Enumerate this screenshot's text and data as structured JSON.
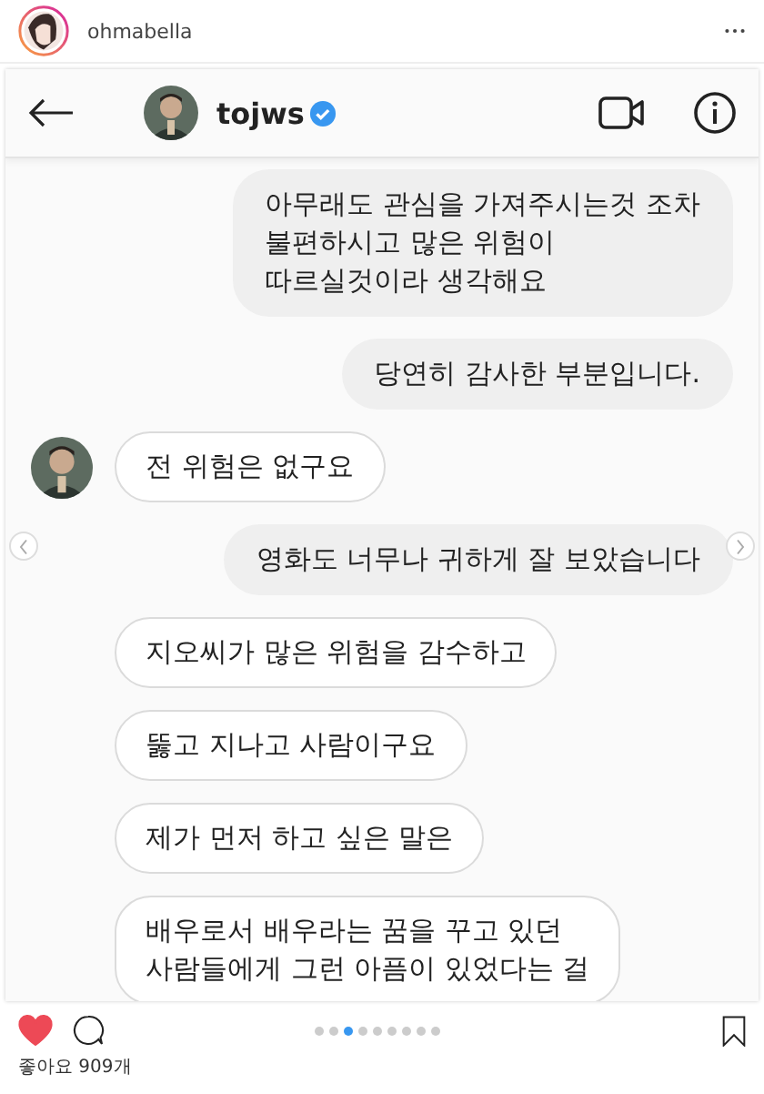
{
  "post": {
    "username": "ohmabella"
  },
  "chat": {
    "username": "tojws",
    "verified": true,
    "messages": [
      {
        "kind": "sent",
        "text": "아무래도 관심을 가져주시는것 조차\n불편하시고 많은 위험이\n따르실것이라 생각해요",
        "avatar": false
      },
      {
        "kind": "sent",
        "text": "당연히 감사한 부분입니다.",
        "avatar": false
      },
      {
        "kind": "received",
        "text": "전 위험은 없구요",
        "avatar": true
      },
      {
        "kind": "sent",
        "text": "영화도 너무나 귀하게 잘 보았습니다",
        "avatar": false
      },
      {
        "kind": "received",
        "text": "지오씨가 많은 위험을 감수하고",
        "avatar": false
      },
      {
        "kind": "received",
        "text": "뚫고 지나고 사람이구요",
        "avatar": false
      },
      {
        "kind": "received",
        "text": "제가 먼저 하고 싶은 말은",
        "avatar": false
      },
      {
        "kind": "received",
        "text": "배우로서 배우라는 꿈을 꾸고 있던\n사람들에게 그런 아픔이 있었다는 걸",
        "avatar": false
      }
    ]
  },
  "liked": true,
  "carousel": [
    {
      "selected": false
    },
    {
      "selected": false
    },
    {
      "selected": true
    },
    {
      "selected": false
    },
    {
      "selected": false
    },
    {
      "selected": false
    },
    {
      "selected": false
    },
    {
      "selected": false
    },
    {
      "selected": false
    }
  ],
  "likes": "좋아요 909개"
}
